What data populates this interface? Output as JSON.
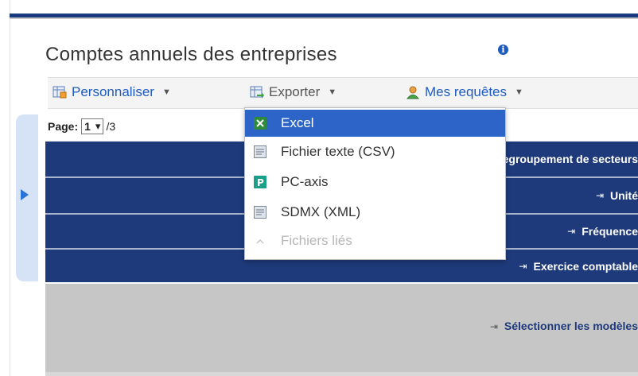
{
  "page": {
    "title": "Comptes annuels des entreprises"
  },
  "toolbar": {
    "personnaliser": "Personnaliser",
    "exporter": "Exporter",
    "mes_requetes": "Mes requêtes"
  },
  "pager": {
    "label": "Page:",
    "current": "1",
    "total": "/3"
  },
  "export_menu": {
    "items": [
      {
        "label": "Excel",
        "icon": "excel-icon",
        "state": "highlighted"
      },
      {
        "label": "Fichier texte (CSV)",
        "icon": "csv-file-icon",
        "state": "normal"
      },
      {
        "label": "PC-axis",
        "icon": "pc-axis-icon",
        "state": "normal"
      },
      {
        "label": "SDMX (XML)",
        "icon": "xml-file-icon",
        "state": "normal"
      },
      {
        "label": "Fichiers liés",
        "icon": "chevron-up-icon",
        "state": "disabled"
      }
    ]
  },
  "dimensions": {
    "bands": [
      {
        "label": "Regroupement de secteurs"
      },
      {
        "label": "Unité"
      },
      {
        "label": "Fréquence"
      },
      {
        "label": "Exercice comptable"
      }
    ],
    "select_models": "Sélectionner les modèles"
  },
  "colors": {
    "band_bg": "#1e3a7a",
    "accent": "#1f5bbf",
    "menu_highlight": "#2d64c8",
    "side_tab": "#d6e3f7"
  }
}
